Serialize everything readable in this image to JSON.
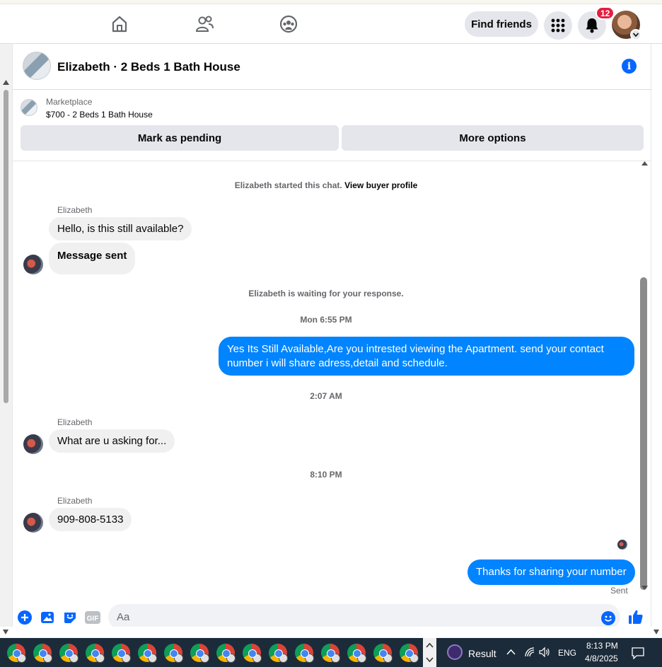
{
  "topnav": {
    "find_friends": "Find friends",
    "notification_count": "12",
    "icons": [
      "home-icon",
      "friends-icon",
      "groups-icon",
      "menu-grid-icon",
      "bell-icon",
      "profile-avatar"
    ]
  },
  "chat": {
    "title": "Elizabeth · 2 Beds 1 Bath House",
    "listing_label": "Marketplace",
    "listing_price_title": "$700 - 2 Beds 1 Bath House",
    "mark_pending": "Mark as pending",
    "more_options": "More options",
    "started_text": "Elizabeth started this chat.",
    "view_buyer_profile": "View buyer profile",
    "messages": [
      {
        "sender": "Elizabeth",
        "text": "Hello, is this still available?"
      },
      {
        "sender": "",
        "text": "Message sent"
      },
      {
        "system": "Elizabeth is waiting for your response."
      },
      {
        "timestamp": "Mon 6:55 PM"
      },
      {
        "sender": "me",
        "text": "Yes Its Still Available,Are you intrested viewing the Apartment. send your contact number i will share adress,detail and schedule."
      },
      {
        "timestamp": "2:07 AM"
      },
      {
        "sender": "Elizabeth",
        "text": "What are u asking for..."
      },
      {
        "timestamp": "8:10 PM"
      },
      {
        "sender": "Elizabeth",
        "text": "909-808-5133"
      },
      {
        "sender": "me",
        "text": "Thanks for sharing your number"
      }
    ],
    "sent_status": "Sent",
    "composer_placeholder": "Aa"
  },
  "taskbar": {
    "result_label": "Result",
    "language": "ENG",
    "time": "8:13 PM",
    "date": "4/8/2025"
  },
  "colors": {
    "accent": "#0866ff",
    "outgoing_bubble": "#0084ff",
    "incoming_bubble": "#f0f0f0",
    "badge": "#e41e3f"
  }
}
